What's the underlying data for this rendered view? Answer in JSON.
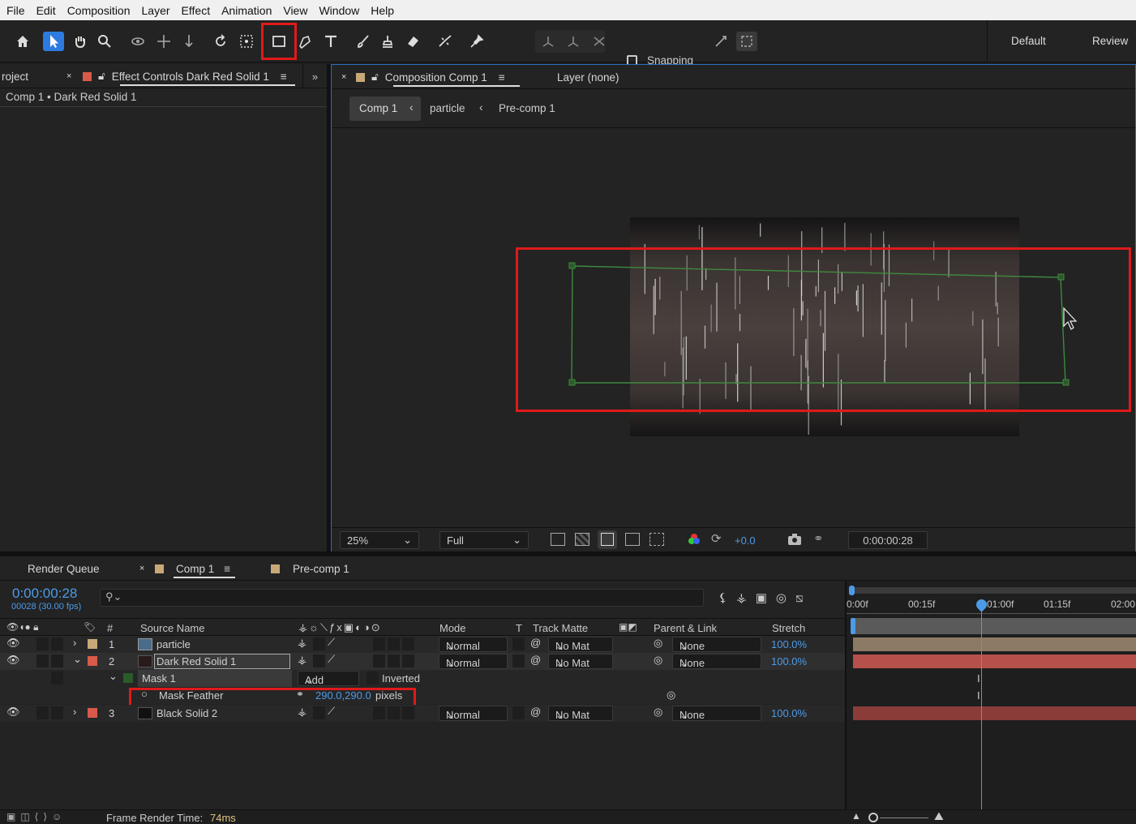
{
  "menu": [
    "File",
    "Edit",
    "Composition",
    "Layer",
    "Effect",
    "Animation",
    "View",
    "Window",
    "Help"
  ],
  "toolbar": {
    "snapping_label": "Snapping",
    "workspaces": [
      "Default",
      "Review"
    ]
  },
  "project_panel": {
    "tab_project": "roject",
    "tab_effect_controls": "Effect Controls Dark Red Solid 1",
    "breadcrumb": "Comp 1 • Dark Red Solid 1"
  },
  "comp_panel": {
    "tab_comp": "Composition Comp 1",
    "tab_layer": "Layer (none)",
    "breadcrumbs": [
      "Comp 1",
      "particle",
      "Pre-comp 1"
    ],
    "footer": {
      "zoom": "25%",
      "resolution": "Full",
      "exposure": "+0.0",
      "timecode": "0:00:00:28"
    }
  },
  "timeline": {
    "tabs": [
      "Render Queue",
      "Comp 1",
      "Pre-comp 1"
    ],
    "timecode": "0:00:00:28",
    "frame_info": "00028 (30.00 fps)",
    "search_placeholder": "",
    "columns": {
      "num": "#",
      "source": "Source Name",
      "mode": "Mode",
      "t": "T",
      "track_matte": "Track Matte",
      "parent": "Parent & Link",
      "stretch": "Stretch"
    },
    "ruler": [
      "0:00f",
      "00:15f",
      "01:00f",
      "01:15f",
      "02:00"
    ],
    "layers": [
      {
        "num": "1",
        "name": "particle",
        "mode": "Normal",
        "matte": "No Mat",
        "parent": "None",
        "stretch": "100.0%",
        "label_color": "#c8a878"
      },
      {
        "num": "2",
        "name": "Dark Red Solid 1",
        "mode": "Normal",
        "matte": "No Mat",
        "parent": "None",
        "stretch": "100.0%",
        "label_color": "#d95a4a"
      },
      {
        "num": "3",
        "name": "Black Solid 2",
        "mode": "Normal",
        "matte": "No Mat",
        "parent": "None",
        "stretch": "100.0%",
        "label_color": "#d95a4a"
      }
    ],
    "mask": {
      "name": "Mask 1",
      "mode": "Add",
      "inverted": "Inverted"
    },
    "mask_feather": {
      "label": "Mask Feather",
      "value": "290.0,290.0",
      "unit": "pixels"
    },
    "status": {
      "label": "Frame Render Time:",
      "value": "74ms"
    }
  },
  "colors": {
    "accent": "#4c9be8",
    "highlight": "#e01a1a",
    "mask_path": "#3f8a3f"
  }
}
